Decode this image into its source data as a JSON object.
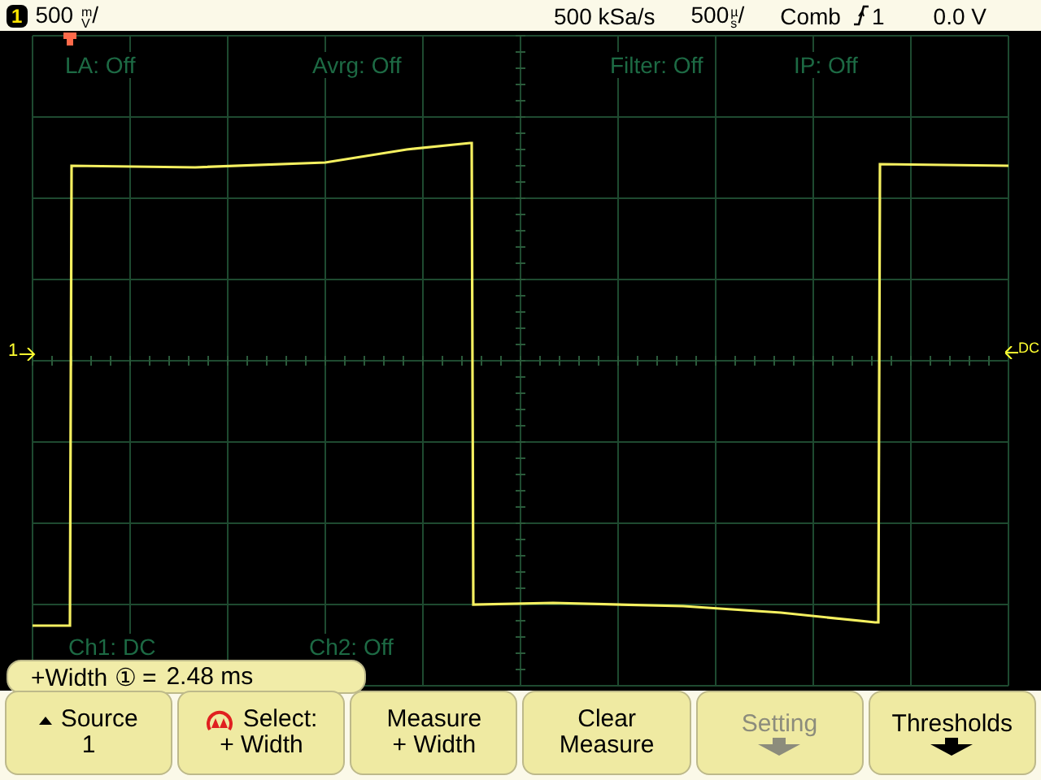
{
  "status_bar": {
    "channel": "1",
    "scale": "500",
    "scale_unit_top": "m",
    "scale_unit_bottom": "V",
    "scale_separator": "/",
    "sample_rate": "500 kSa/s",
    "timebase": "500",
    "time_unit_top": "µ",
    "time_unit_bottom": "s",
    "time_separator": "/",
    "trigger_mode": "Comb",
    "trigger_source": "1",
    "trigger_level": "0.0 V"
  },
  "screen_labels_top": [
    "LA: Off",
    "Avrg: Off",
    "Filter: Off",
    "IP: Off"
  ],
  "screen_labels_bottom": [
    "Ch1: DC",
    "Ch2: Off"
  ],
  "markers": {
    "ground": "1",
    "coupling": "DC"
  },
  "measurement": {
    "name": "+Width",
    "channel": "①",
    "equals": "=",
    "value": "2.48 ms"
  },
  "softkeys": [
    {
      "lines": [
        "Source",
        "1"
      ],
      "kind": "caret",
      "disabled": false
    },
    {
      "lines": [
        "Select:",
        "+ Width"
      ],
      "kind": "knob",
      "disabled": false
    },
    {
      "lines": [
        "Measure",
        "+ Width"
      ],
      "kind": "plain",
      "disabled": false
    },
    {
      "lines": [
        "Clear",
        "Measure"
      ],
      "kind": "plain",
      "disabled": false
    },
    {
      "lines": [
        "Setting"
      ],
      "kind": "arrow",
      "disabled": true
    },
    {
      "lines": [
        "Thresholds"
      ],
      "kind": "arrow",
      "disabled": false
    }
  ]
}
